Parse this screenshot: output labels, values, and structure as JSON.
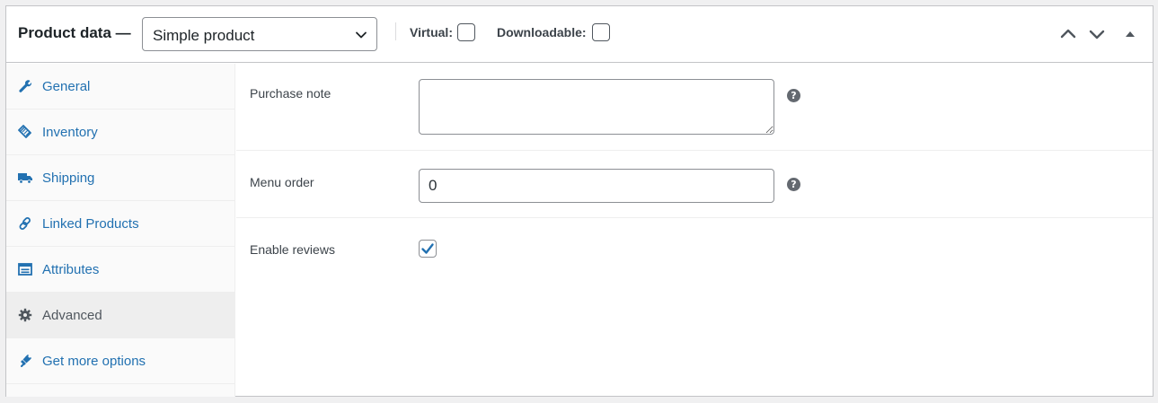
{
  "header": {
    "title": "Product data —",
    "product_type": "Simple product",
    "virtual_label": "Virtual:",
    "downloadable_label": "Downloadable:",
    "virtual_checked": false,
    "downloadable_checked": false,
    "icons": [
      "move-up-icon",
      "move-down-icon",
      "collapse-icon"
    ]
  },
  "sidebar": {
    "items": [
      {
        "label": "General",
        "icon": "wrench-icon",
        "active": false
      },
      {
        "label": "Inventory",
        "icon": "tag-icon",
        "active": false
      },
      {
        "label": "Shipping",
        "icon": "truck-icon",
        "active": false
      },
      {
        "label": "Linked Products",
        "icon": "link-icon",
        "active": false
      },
      {
        "label": "Attributes",
        "icon": "list-icon",
        "active": false
      },
      {
        "label": "Advanced",
        "icon": "gear-icon",
        "active": true
      },
      {
        "label": "Get more options",
        "icon": "plug-icon",
        "active": false
      }
    ]
  },
  "main": {
    "purchase_note": {
      "label": "Purchase note",
      "value": ""
    },
    "menu_order": {
      "label": "Menu order",
      "value": "0"
    },
    "enable_reviews": {
      "label": "Enable reviews",
      "checked": true
    },
    "help_glyph": "?"
  },
  "colors": {
    "link": "#2271b1",
    "active_tab_bg": "#eeeeee",
    "sidebar_bg": "#fafafa",
    "border": "#c3c4c7",
    "help_icon": "#646970"
  }
}
